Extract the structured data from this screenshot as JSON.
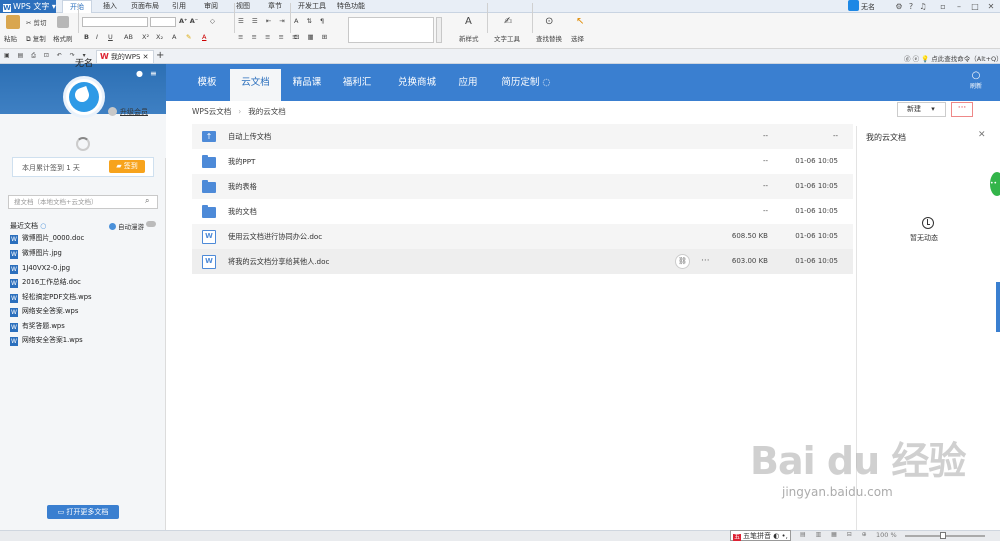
{
  "app": {
    "name": "WPS 文字"
  },
  "menu_tabs": [
    "开始",
    "插入",
    "页面布局",
    "引用",
    "审阅",
    "视图",
    "章节",
    "开发工具",
    "特色功能"
  ],
  "top_right": {
    "user": "无名"
  },
  "ribbon": {
    "paste": "粘贴",
    "cut": "剪切",
    "copy": "复制",
    "format_painter": "格式刷",
    "new_style": "新样式",
    "text_tools": "文字工具",
    "find_replace": "查找替换",
    "select": "选择"
  },
  "quick_bar": {
    "doc_tab": "我的WPS",
    "command_search": "点此查找命令（Alt+Q）"
  },
  "left_panel": {
    "username": "无名",
    "upgrade": "升级会员",
    "checkin_text": "本月累计签到 1 天",
    "checkin_button": "签到",
    "search_placeholder": "搜文档（本地文档+云文档）",
    "recent_title": "最近文档",
    "auto_roam": "自动漫游",
    "recent_docs": [
      "微博图片_0000.doc",
      "微博图片.jpg",
      "1J40VX2-0.jpg",
      "2016工作总结.doc",
      "轻松搞定PDF文档.wps",
      "网络安全答案.wps",
      "有奖答题.wps",
      "网络安全答案1.wps"
    ],
    "open_more": "打开更多文档"
  },
  "nav_tabs": [
    "模板",
    "云文档",
    "精品课",
    "福利汇",
    "兑换商城",
    "应用",
    "简历定制"
  ],
  "refresh": "刷新",
  "breadcrumb": [
    "WPS云文档",
    "我的云文档"
  ],
  "toolbar": {
    "new_label": "新建",
    "more_label": "···"
  },
  "files": [
    {
      "name": "自动上传文档",
      "size": "--",
      "date": "--",
      "type": "upload"
    },
    {
      "name": "我的PPT",
      "size": "--",
      "date": "01-06 10:05",
      "type": "folder"
    },
    {
      "name": "我的表格",
      "size": "--",
      "date": "01-06 10:05",
      "type": "folder"
    },
    {
      "name": "我的文档",
      "size": "--",
      "date": "01-06 10:05",
      "type": "folder"
    },
    {
      "name": "使用云文档进行协同办公.doc",
      "size": "608.50 KB",
      "date": "01-06 10:05",
      "type": "doc"
    },
    {
      "name": "将我的云文档分享给其他人.doc",
      "size": "603.00 KB",
      "date": "01-06 10:05",
      "type": "doc"
    }
  ],
  "right_pane": {
    "title": "我的云文档",
    "empty": "暂无动态"
  },
  "statusbar": {
    "ime": "五笔拼音",
    "zoom": "100 %"
  },
  "watermark": {
    "logo": "Bai du 经验",
    "url": "jingyan.baidu.com"
  },
  "colors": {
    "brand": "#3a7fd0",
    "accent": "#f7a31c"
  }
}
